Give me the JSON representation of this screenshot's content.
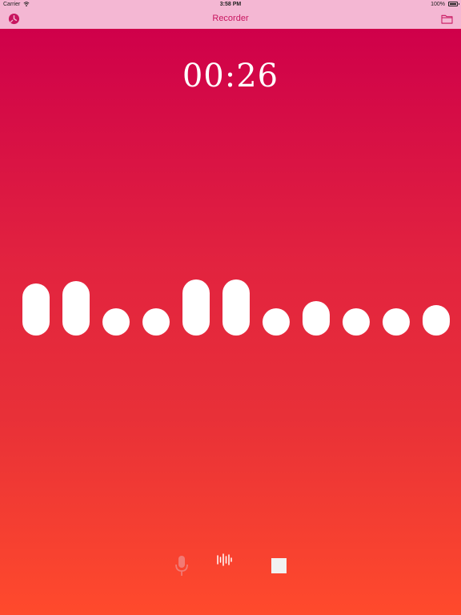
{
  "status_bar": {
    "carrier": "Carrier",
    "time": "3:58 PM",
    "battery": "100%"
  },
  "nav": {
    "title": "Recorder",
    "left_icon": "history-clock-icon",
    "right_icon": "folder-icon"
  },
  "timer": "00:26",
  "waveform": {
    "levels": [
      0.65,
      0.68,
      0.26,
      0.26,
      0.7,
      0.7,
      0.34,
      0.43,
      0.23,
      0.23,
      0.38
    ]
  },
  "controls": {
    "record_icon": "microphone-icon",
    "waveform_icon": "waveform-icon",
    "stop_icon": "stop-icon"
  },
  "colors": {
    "nav_background": "#f4b7d3",
    "accent": "#c8155f",
    "gradient_top": "#cf004a",
    "gradient_bottom": "#ff4a2c",
    "foreground": "#ffffff"
  }
}
